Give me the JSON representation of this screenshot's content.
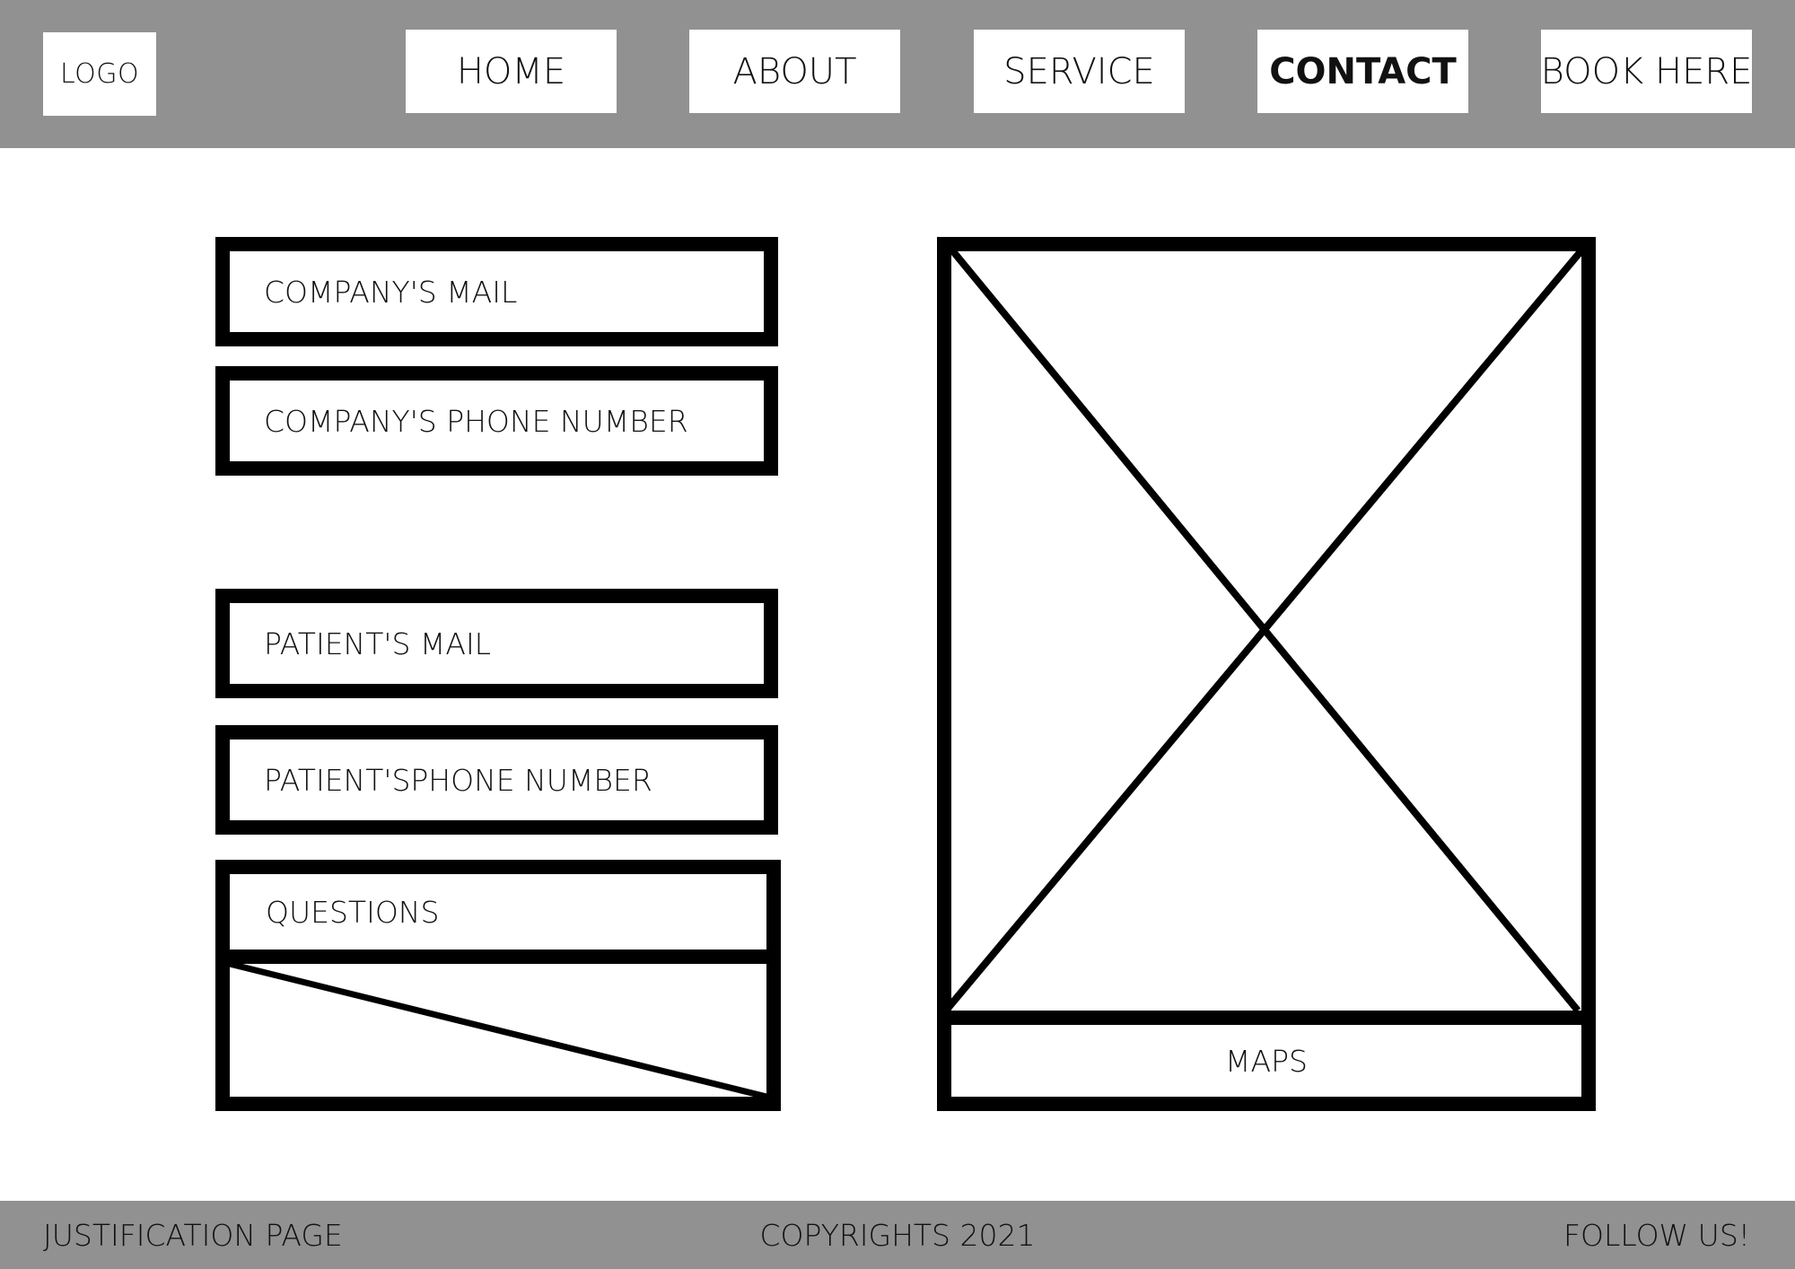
{
  "header": {
    "logo": "LOGO",
    "nav": [
      {
        "label": "HOME",
        "active": false
      },
      {
        "label": "ABOUT",
        "active": false
      },
      {
        "label": "SERVICE",
        "active": false
      },
      {
        "label": "CONTACT",
        "active": true
      },
      {
        "label": "BOOK HERE",
        "active": false
      }
    ]
  },
  "form": {
    "company_mail": "COMPANY'S MAIL",
    "company_phone": "COMPANY'S PHONE NUMBER",
    "patient_mail": "PATIENT'S MAIL",
    "patient_phone": "PATIENT'SPHONE NUMBER",
    "questions": "QUESTIONS"
  },
  "map": {
    "label": "MAPS"
  },
  "footer": {
    "justification": "JUSTIFICATION PAGE",
    "copyright": "COPYRIGHTS 2021",
    "follow": "FOLLOW US!"
  },
  "colors": {
    "bar": "#919191",
    "stroke": "#000000",
    "background": "#ffffff"
  }
}
